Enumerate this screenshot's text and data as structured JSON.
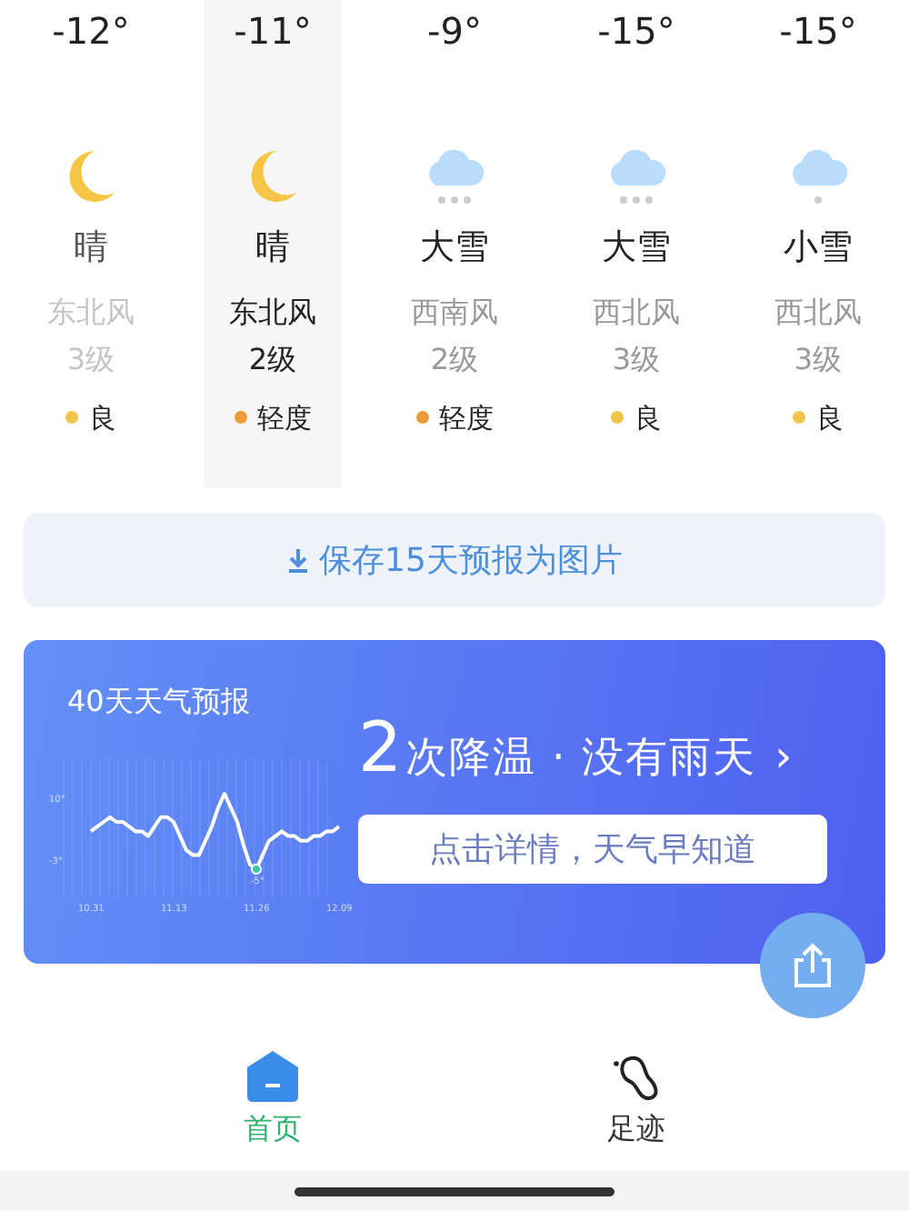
{
  "days": [
    {
      "temp": "-12°",
      "kind": "moon",
      "condition": "晴",
      "wind": "东北风",
      "wind_level": "3级",
      "aqi": "良",
      "color": "#f2c54a",
      "past": true,
      "selected": false
    },
    {
      "temp": "-11°",
      "kind": "moon",
      "condition": "晴",
      "wind": "东北风",
      "wind_level": "2级",
      "aqi": "轻度",
      "color": "#ee9a3c",
      "past": false,
      "selected": true
    },
    {
      "temp": "-9°",
      "kind": "heavy-snow",
      "condition": "大雪",
      "wind": "西南风",
      "wind_level": "2级",
      "aqi": "轻度",
      "color": "#ee9a3c",
      "past": false,
      "selected": false
    },
    {
      "temp": "-15°",
      "kind": "heavy-snow",
      "condition": "大雪",
      "wind": "西北风",
      "wind_level": "3级",
      "aqi": "良",
      "color": "#f2c54a",
      "past": false,
      "selected": false
    },
    {
      "temp": "-15°",
      "kind": "light-snow",
      "condition": "小雪",
      "wind": "西北风",
      "wind_level": "3级",
      "aqi": "良",
      "color": "#f2c54a",
      "past": false,
      "selected": false
    }
  ],
  "save_button": {
    "label": "保存15天预报为图片"
  },
  "banner": {
    "title": "40天天气预报",
    "headline_number": "2",
    "headline": "次降温 · 没有雨天",
    "chevron": "›",
    "button": "点击详情，天气早知道",
    "chart_data": {
      "type": "line",
      "categories": [
        "10.31",
        null,
        null,
        null,
        null,
        null,
        null,
        null,
        null,
        null,
        null,
        null,
        null,
        "11.13",
        null,
        null,
        null,
        null,
        null,
        null,
        null,
        null,
        null,
        null,
        null,
        null,
        "11.26",
        null,
        null,
        null,
        null,
        null,
        null,
        null,
        null,
        null,
        null,
        null,
        null,
        "12.09"
      ],
      "series": [
        {
          "color": "#ffffff",
          "values": [
            3,
            4,
            5,
            6,
            5,
            5,
            4,
            3,
            3,
            2,
            4,
            6,
            6,
            5,
            2,
            -1,
            -2,
            -2,
            1,
            4,
            8,
            11,
            8,
            5,
            0,
            -4,
            -5,
            -2,
            1,
            2,
            3,
            2,
            2,
            1,
            1,
            2,
            2,
            3,
            3,
            4
          ]
        }
      ],
      "ylim": [
        -10.8,
        18.5
      ],
      "yticks": [
        {
          "value": 10,
          "label": "10°"
        },
        {
          "value": -3,
          "label": "-3°"
        }
      ],
      "annotations": [
        {
          "x": "11.26",
          "y": -5,
          "text": "-5°"
        }
      ]
    }
  },
  "nav": [
    {
      "label": "首页",
      "kind": "home",
      "selected": true
    },
    {
      "label": "足迹",
      "kind": "footprint",
      "selected": false
    }
  ]
}
